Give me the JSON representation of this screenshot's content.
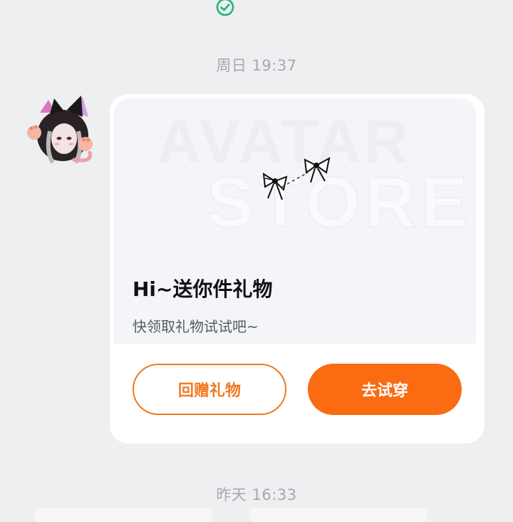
{
  "status": {
    "icon": "check-circle-icon",
    "color": "#1fb574"
  },
  "timestamps": {
    "first": "周日 19:37",
    "second": "昨天 16:33"
  },
  "message": {
    "avatar_icon": "cat-ear-girl-avatar",
    "banner": {
      "watermark_line1": "AVATAR",
      "watermark_line2": "STORE",
      "icon": "bow-ribbon-icon"
    },
    "title": "Hi~送你件礼物",
    "subtitle": "快领取礼物试试吧~",
    "buttons": {
      "secondary_label": "回赠礼物",
      "primary_label": "去试穿"
    }
  },
  "colors": {
    "accent": "#fa6b12",
    "accent_outline": "#ee7a20",
    "background": "#eeeff1",
    "card": "#ffffff"
  }
}
